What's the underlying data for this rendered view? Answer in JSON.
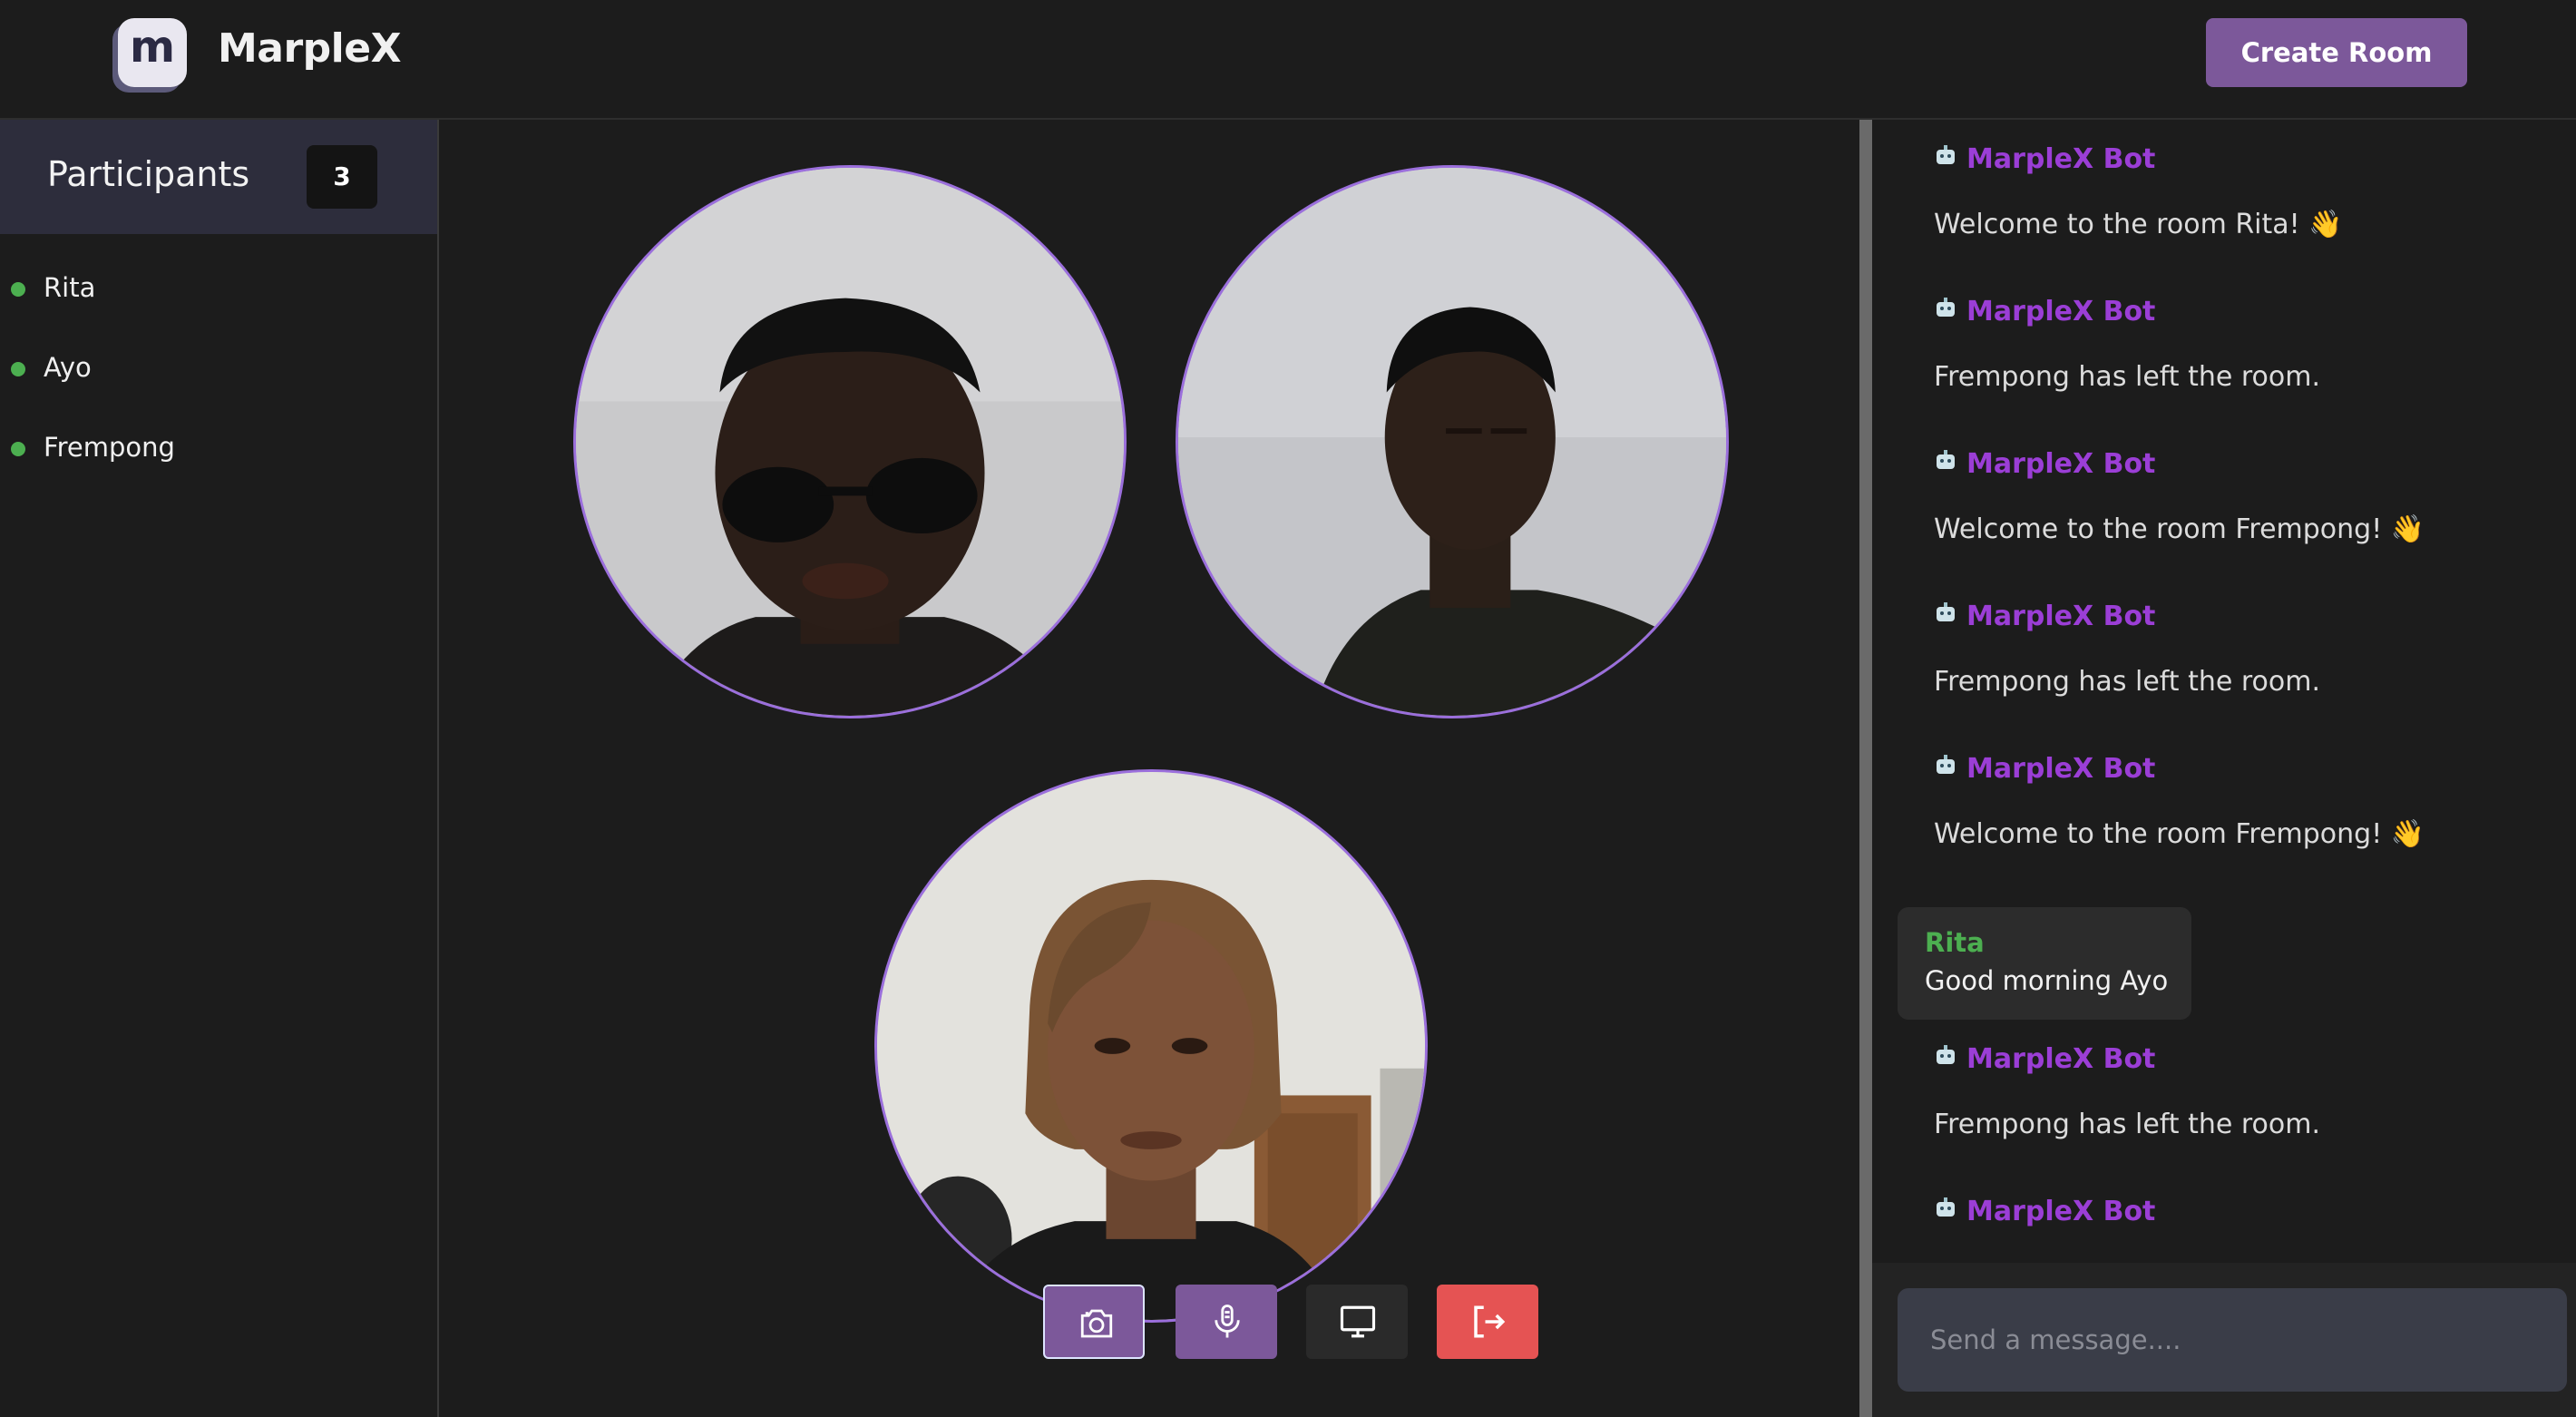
{
  "app": {
    "brand": "MarpleX",
    "logo_letter": "m"
  },
  "header": {
    "create_room_label": "Create Room"
  },
  "participants": {
    "title": "Participants",
    "count": "3",
    "list": [
      "Rita",
      "Ayo",
      "Frempong"
    ]
  },
  "controls": {
    "camera_icon": "camera-icon",
    "mic_icon": "microphone-icon",
    "screen_icon": "screen-share-icon",
    "leave_icon": "leave-room-icon"
  },
  "chat": {
    "bot_name": "MarpleX Bot",
    "messages": [
      {
        "sender": "MarpleX Bot",
        "text": "Welcome to the room Rita! 👋"
      },
      {
        "sender": "MarpleX Bot",
        "text": "Frempong has left the room."
      },
      {
        "sender": "MarpleX Bot",
        "text": "Welcome to the room Frempong! 👋"
      },
      {
        "sender": "MarpleX Bot",
        "text": "Frempong has left the room."
      },
      {
        "sender": "MarpleX Bot",
        "text": "Welcome to the room Frempong! 👋"
      },
      {
        "sender": "Rita",
        "text": "Good morning Ayo"
      },
      {
        "sender": "MarpleX Bot",
        "text": "Frempong has left the room."
      },
      {
        "sender": "MarpleX Bot",
        "text": ""
      }
    ],
    "input_placeholder": "Send a message...."
  },
  "colors": {
    "accent": "#7c589a",
    "bot_name": "#9b3ed6",
    "online": "#4caf50",
    "leave": "#e55353",
    "video_ring": "#9b6fdc"
  }
}
